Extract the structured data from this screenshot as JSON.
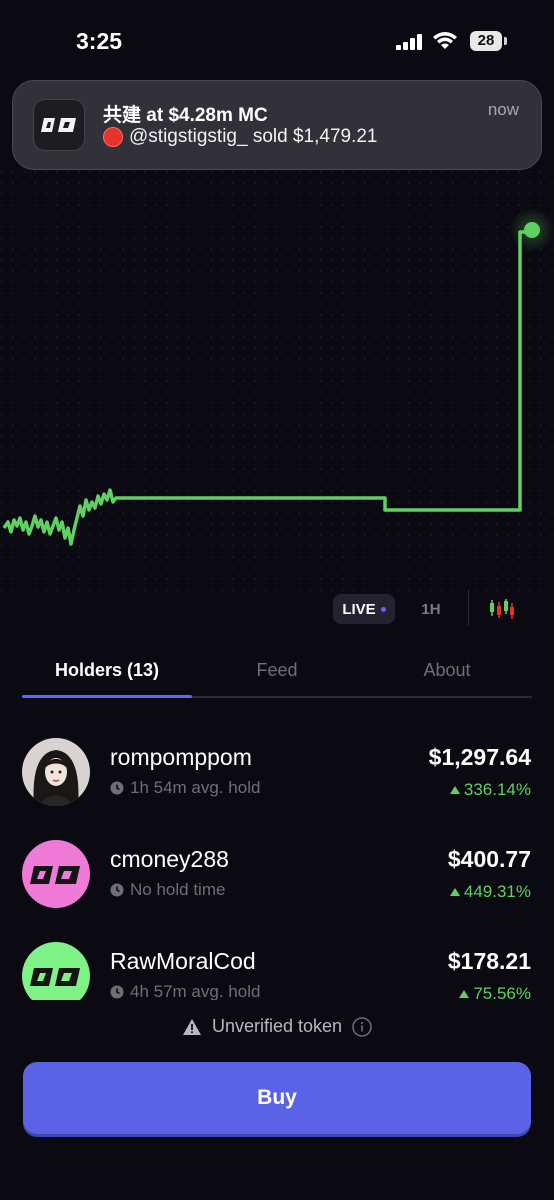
{
  "status_bar": {
    "time": "3:25",
    "battery": "28"
  },
  "notification": {
    "title": "共建 at $4.28m MC",
    "body": "@stigstigstig_ sold $1,479.21",
    "time": "now"
  },
  "chart_controls": {
    "live_label": "LIVE",
    "h1_label": "1H"
  },
  "tabs": [
    {
      "label": "Holders (13)",
      "active": true
    },
    {
      "label": "Feed",
      "active": false
    },
    {
      "label": "About",
      "active": false
    }
  ],
  "holders": [
    {
      "name": "rompomppom",
      "hold": "1h 54m avg. hold",
      "value": "$1,297.64",
      "change": "336.14%"
    },
    {
      "name": "cmoney288",
      "hold": "No hold time",
      "value": "$400.77",
      "change": "449.31%"
    },
    {
      "name": "RawMoralCod",
      "hold": "4h 57m avg. hold",
      "value": "$178.21",
      "change": "75.56%"
    }
  ],
  "warning": {
    "text": "Unverified token"
  },
  "buy": {
    "label": "Buy"
  },
  "colors": {
    "accent": "#5a63e6",
    "positive": "#5fd160",
    "background": "#0b0a12"
  }
}
